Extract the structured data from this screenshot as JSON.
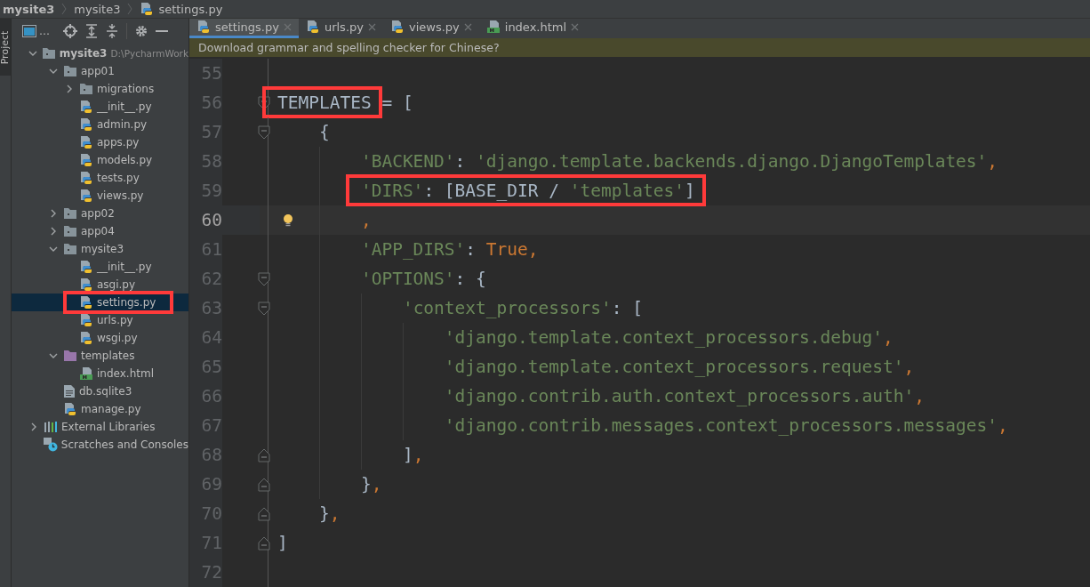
{
  "breadcrumb": [
    {
      "label": "mysite3",
      "kind": "project"
    },
    {
      "label": "mysite3",
      "kind": "folder"
    },
    {
      "label": "settings.py",
      "kind": "py"
    }
  ],
  "side_strip": {
    "label": "Project",
    "selected": true
  },
  "project_toolbar": {
    "view_label": "…"
  },
  "tree": [
    {
      "label": "mysite3",
      "path": "D:\\PycharmWork",
      "kind": "folder",
      "expanded": true,
      "selected": false,
      "children": [
        {
          "label": "app01",
          "kind": "folder",
          "expanded": true,
          "selected": false,
          "children": [
            {
              "label": "migrations",
              "kind": "folder",
              "expanded": false,
              "selected": false
            },
            {
              "label": "__init__.py",
              "kind": "py",
              "selected": false
            },
            {
              "label": "admin.py",
              "kind": "py",
              "selected": false
            },
            {
              "label": "apps.py",
              "kind": "py",
              "selected": false
            },
            {
              "label": "models.py",
              "kind": "py",
              "selected": false
            },
            {
              "label": "tests.py",
              "kind": "py",
              "selected": false
            },
            {
              "label": "views.py",
              "kind": "py",
              "selected": false
            }
          ]
        },
        {
          "label": "app02",
          "kind": "folder",
          "expanded": false,
          "selected": false
        },
        {
          "label": "app04",
          "kind": "folder",
          "expanded": false,
          "selected": false
        },
        {
          "label": "mysite3",
          "kind": "folder",
          "expanded": true,
          "selected": false,
          "children": [
            {
              "label": "__init__.py",
              "kind": "py",
              "selected": false
            },
            {
              "label": "asgi.py",
              "kind": "py",
              "selected": false
            },
            {
              "label": "settings.py",
              "kind": "py",
              "selected": true,
              "boxed": true
            },
            {
              "label": "urls.py",
              "kind": "py",
              "selected": false
            },
            {
              "label": "wsgi.py",
              "kind": "py",
              "selected": false
            }
          ]
        },
        {
          "label": "templates",
          "kind": "template_folder",
          "expanded": true,
          "selected": false,
          "children": [
            {
              "label": "index.html",
              "kind": "html",
              "selected": false
            }
          ]
        },
        {
          "label": "db.sqlite3",
          "kind": "file",
          "selected": false
        },
        {
          "label": "manage.py",
          "kind": "py",
          "selected": false
        }
      ]
    },
    {
      "label": "External Libraries",
      "kind": "library",
      "expanded": false,
      "selected": false
    },
    {
      "label": "Scratches and Consoles",
      "kind": "scratches",
      "selected": false
    }
  ],
  "tabs": [
    {
      "label": "settings.py",
      "kind": "py",
      "selected": true
    },
    {
      "label": "urls.py",
      "kind": "py",
      "selected": false
    },
    {
      "label": "views.py",
      "kind": "py",
      "selected": false
    },
    {
      "label": "index.html",
      "kind": "html",
      "selected": false
    }
  ],
  "notification": "Download grammar and spelling checker for Chinese?",
  "code_lines": [
    {
      "number": "55"
    },
    {
      "number": "56",
      "fold_start": true,
      "tokens": [
        {
          "text": "TEMPLATES",
          "kind": "plain",
          "boxed": true
        },
        {
          "text": " = [",
          "kind": "plain",
          "boxed": false
        }
      ]
    },
    {
      "number": "57",
      "fold_start": true,
      "tokens": [
        {
          "text": "    {",
          "kind": "plain",
          "boxed": false
        }
      ]
    },
    {
      "number": "58",
      "tokens": [
        {
          "text": "        'BACKEND'",
          "kind": "string",
          "boxed": false
        },
        {
          "text": ": ",
          "kind": "plain",
          "boxed": false
        },
        {
          "text": "'django.template.backends.django.DjangoTemplates'",
          "kind": "string",
          "boxed": false
        },
        {
          "text": ",",
          "kind": "keyword",
          "boxed": false
        }
      ]
    },
    {
      "number": "59",
      "tokens": [
        {
          "text": "        'DIRS'",
          "kind": "string",
          "boxed": true
        },
        {
          "text": ": [BASE_DIR / ",
          "kind": "plain",
          "boxed": true
        },
        {
          "text": "'templates'",
          "kind": "string",
          "boxed": true
        },
        {
          "text": "]",
          "kind": "plain",
          "boxed": true
        }
      ]
    },
    {
      "number": "60",
      "current": true,
      "intention_bulb": true,
      "tokens": [
        {
          "text": "        ,",
          "kind": "keyword",
          "boxed": false
        }
      ]
    },
    {
      "number": "61",
      "tokens": [
        {
          "text": "        'APP_DIRS'",
          "kind": "string",
          "boxed": false
        },
        {
          "text": ": ",
          "kind": "plain",
          "boxed": false
        },
        {
          "text": "True",
          "kind": "keyword",
          "boxed": false
        },
        {
          "text": ",",
          "kind": "keyword",
          "boxed": false
        }
      ]
    },
    {
      "number": "62",
      "fold_start": true,
      "tokens": [
        {
          "text": "        'OPTIONS'",
          "kind": "string",
          "boxed": false
        },
        {
          "text": ": {",
          "kind": "plain",
          "boxed": false
        }
      ]
    },
    {
      "number": "63",
      "fold_start": true,
      "tokens": [
        {
          "text": "            'context_processors'",
          "kind": "string",
          "boxed": false
        },
        {
          "text": ": [",
          "kind": "plain",
          "boxed": false
        }
      ]
    },
    {
      "number": "64",
      "tokens": [
        {
          "text": "                'django.template.context_processors.debug'",
          "kind": "string",
          "boxed": false
        },
        {
          "text": ",",
          "kind": "keyword",
          "boxed": false
        }
      ]
    },
    {
      "number": "65",
      "tokens": [
        {
          "text": "                'django.template.context_processors.request'",
          "kind": "string",
          "boxed": false
        },
        {
          "text": ",",
          "kind": "keyword",
          "boxed": false
        }
      ]
    },
    {
      "number": "66",
      "tokens": [
        {
          "text": "                'django.contrib.auth.context_processors.auth'",
          "kind": "string",
          "boxed": false
        },
        {
          "text": ",",
          "kind": "keyword",
          "boxed": false
        }
      ]
    },
    {
      "number": "67",
      "tokens": [
        {
          "text": "                'django.contrib.messages.context_processors.messages'",
          "kind": "string",
          "boxed": false
        },
        {
          "text": ",",
          "kind": "keyword",
          "boxed": false
        }
      ]
    },
    {
      "number": "68",
      "fold_end": true,
      "tokens": [
        {
          "text": "            ]",
          "kind": "plain",
          "boxed": false
        },
        {
          "text": ",",
          "kind": "keyword",
          "boxed": false
        }
      ]
    },
    {
      "number": "69",
      "fold_end": true,
      "tokens": [
        {
          "text": "        }",
          "kind": "plain",
          "boxed": false
        },
        {
          "text": ",",
          "kind": "keyword",
          "boxed": false
        }
      ]
    },
    {
      "number": "70",
      "fold_end": true,
      "tokens": [
        {
          "text": "    }",
          "kind": "plain",
          "boxed": false
        },
        {
          "text": ",",
          "kind": "keyword",
          "boxed": false
        }
      ]
    },
    {
      "number": "71",
      "fold_end": true,
      "tokens": [
        {
          "text": "]",
          "kind": "plain",
          "boxed": false
        }
      ]
    },
    {
      "number": "72"
    }
  ]
}
